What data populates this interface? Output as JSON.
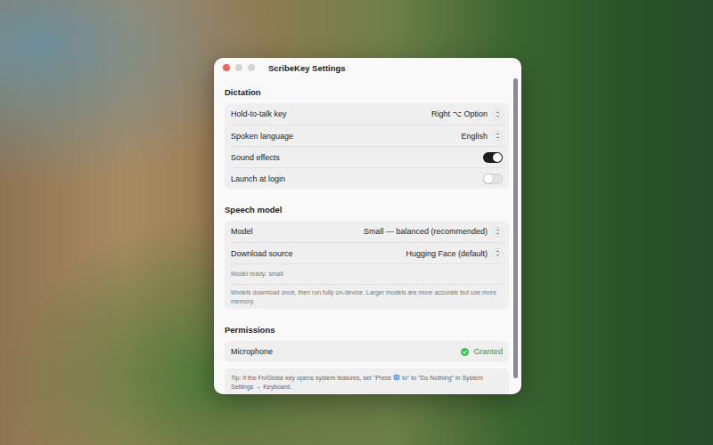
{
  "window": {
    "title": "ScribeKey Settings"
  },
  "sections": [
    {
      "heading": "Dictation",
      "rows": [
        {
          "kind": "select",
          "label": "Hold-to-talk key",
          "value": "Right ⌥ Option"
        },
        {
          "kind": "select",
          "label": "Spoken language",
          "value": "English"
        },
        {
          "kind": "toggle",
          "label": "Sound effects",
          "on": true
        },
        {
          "kind": "toggle",
          "label": "Launch at login",
          "on": false
        }
      ]
    },
    {
      "heading": "Speech model",
      "rows": [
        {
          "kind": "select",
          "label": "Model",
          "value": "Small — balanced (recommended)"
        },
        {
          "kind": "select",
          "label": "Download source",
          "value": "Hugging Face (default)"
        },
        {
          "kind": "note",
          "text": "Model ready: small"
        },
        {
          "kind": "note",
          "text": "Models download once, then run fully on-device. Larger models are more accurate but use more memory."
        }
      ]
    },
    {
      "heading": "Permissions",
      "rows": [
        {
          "kind": "status",
          "label": "Microphone",
          "value": "Granted",
          "granted": true
        }
      ]
    }
  ],
  "tip": {
    "before": "Tip: if the Fn/Globe key opens system features, set \"Press",
    "after": "to\" to \"Do Nothing\" in System Settings → Keyboard."
  },
  "scrollbar": {
    "level": 0.95
  }
}
